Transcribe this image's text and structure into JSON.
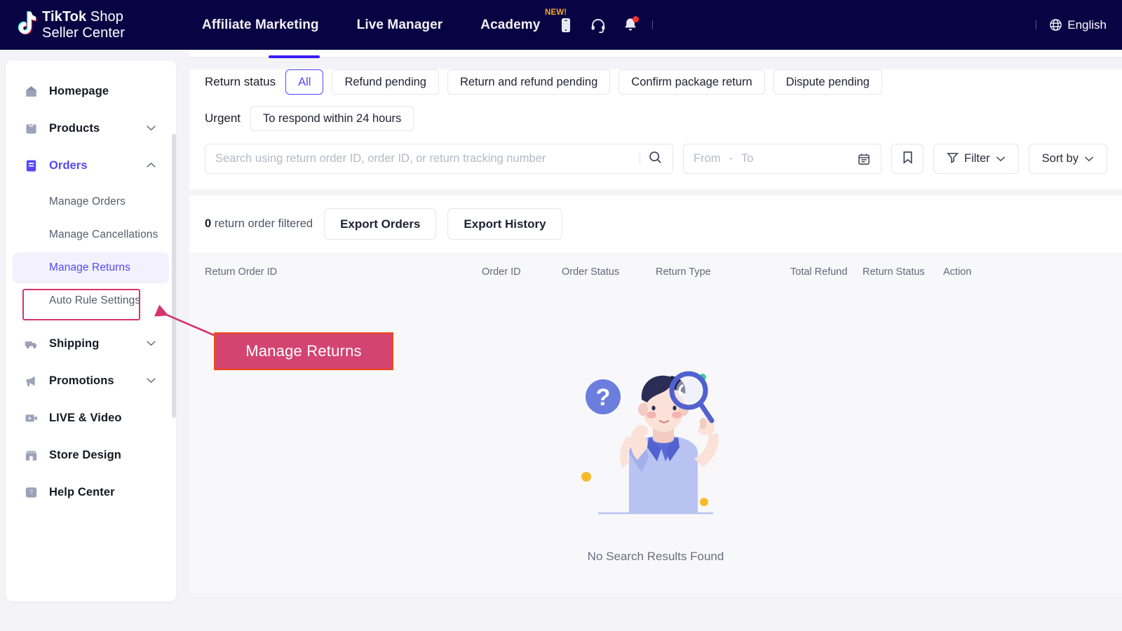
{
  "header": {
    "logo_line1_bold": "TikTok",
    "logo_line1_rest": " Shop",
    "logo_line2": "Seller Center",
    "nav": [
      {
        "label": "Affiliate Marketing",
        "badge": ""
      },
      {
        "label": "Live Manager",
        "badge": ""
      },
      {
        "label": "Academy",
        "badge": "NEW!"
      }
    ],
    "icons": [
      "mobile-icon",
      "headset-icon",
      "bell-icon"
    ],
    "language": "English"
  },
  "sidebar": {
    "items": [
      {
        "label": "Homepage",
        "icon": "home-icon",
        "expandable": false,
        "active": false
      },
      {
        "label": "Products",
        "icon": "bag-icon",
        "expandable": true,
        "active": false
      },
      {
        "label": "Orders",
        "icon": "orders-icon",
        "expandable": true,
        "active": true
      }
    ],
    "orders_sub": [
      {
        "label": "Manage Orders",
        "selected": false
      },
      {
        "label": "Manage Cancellations",
        "selected": false
      },
      {
        "label": "Manage Returns",
        "selected": true
      },
      {
        "label": "Auto Rule Settings",
        "selected": false
      }
    ],
    "items_lower": [
      {
        "label": "Shipping",
        "icon": "truck-icon",
        "expandable": true
      },
      {
        "label": "Promotions",
        "icon": "megaphone-icon",
        "expandable": true
      },
      {
        "label": "LIVE & Video",
        "icon": "video-icon",
        "expandable": false
      },
      {
        "label": "Store Design",
        "icon": "store-icon",
        "expandable": false
      },
      {
        "label": "Help Center",
        "icon": "help-icon",
        "expandable": false
      }
    ]
  },
  "filters": {
    "return_status_label": "Return status",
    "return_status_options": [
      {
        "label": "All",
        "selected": true
      },
      {
        "label": "Refund pending",
        "selected": false
      },
      {
        "label": "Return and refund pending",
        "selected": false
      },
      {
        "label": "Confirm package return",
        "selected": false
      },
      {
        "label": "Dispute pending",
        "selected": false
      }
    ],
    "urgent_label": "Urgent",
    "urgent_options": [
      {
        "label": "To respond within 24 hours",
        "selected": false
      }
    ]
  },
  "search": {
    "placeholder": "Search using return order ID, order ID, or return tracking number",
    "value": "",
    "date_from": "From",
    "date_dash": "-",
    "date_to": "To",
    "bookmark_icon": "bookmark-icon",
    "filter_label": "Filter",
    "sort_label": "Sort by"
  },
  "toolbar": {
    "count": "0",
    "count_suffix": " return order filtered",
    "export_orders": "Export Orders",
    "export_history": "Export History"
  },
  "table": {
    "columns": [
      "Return Order ID",
      "Order ID",
      "Order Status",
      "Return Type",
      "Total Refund",
      "Return Status",
      "Action"
    ]
  },
  "empty_state": {
    "message": "No Search Results Found",
    "illustration": "person-with-magnifier-illustration"
  },
  "annotation": {
    "callout_text": "Manage Returns",
    "callout_fill": "#d44470",
    "callout_border": "#f04a1a",
    "arrow_color": "#d6336c",
    "highlight_border": "#d6336c"
  },
  "colors": {
    "topbar_bg": "#080444",
    "accent": "#5648f5",
    "page_bg": "#f4f4f8",
    "card_bg": "#ffffff",
    "tab_active": "#3a1ff0"
  }
}
